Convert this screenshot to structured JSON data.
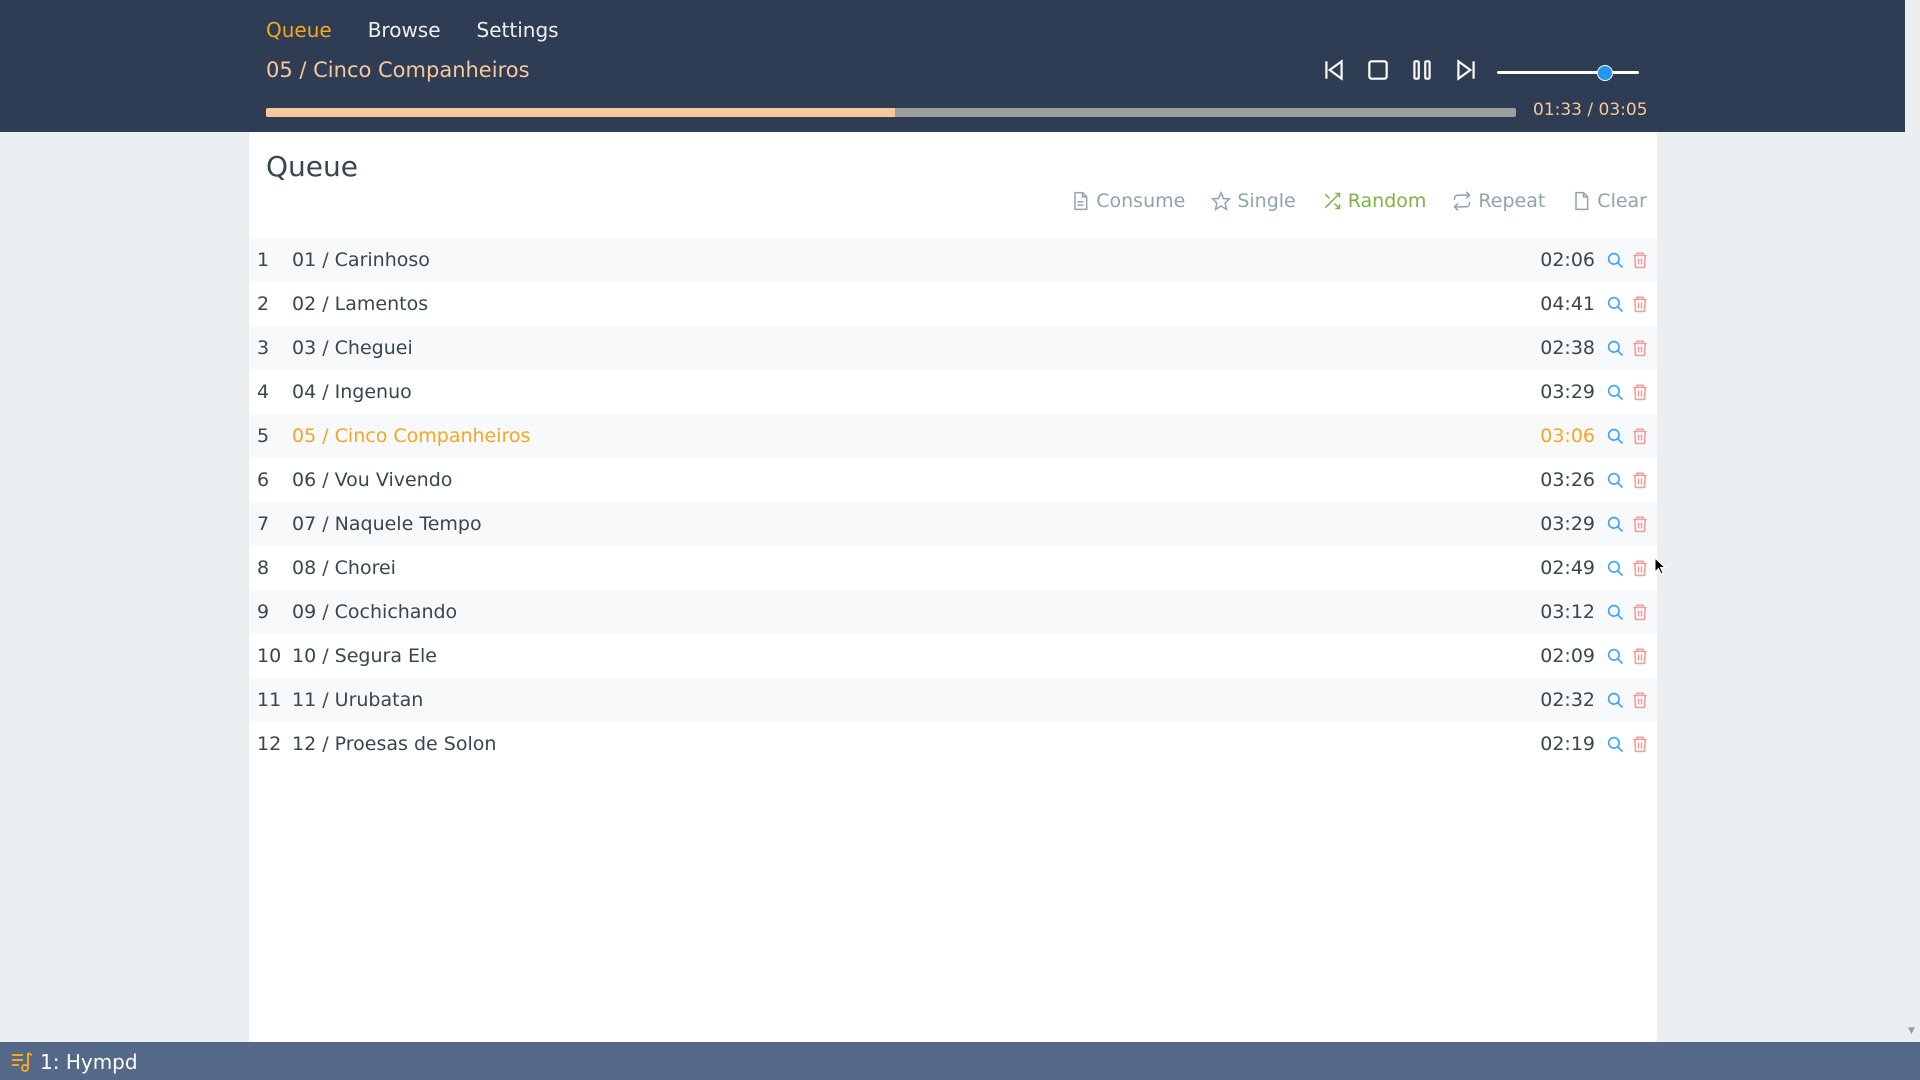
{
  "nav": {
    "items": [
      "Queue",
      "Browse",
      "Settings"
    ],
    "active": "Queue"
  },
  "now_playing": {
    "title": "05 / Cinco Companheiros",
    "elapsed_total": "01:33 / 03:05",
    "progress_fraction": 0.503
  },
  "controls": {
    "icons": [
      "skip-previous-icon",
      "stop-icon",
      "pause-icon",
      "skip-next-icon"
    ]
  },
  "volume": {
    "level_fraction": 0.76
  },
  "queue": {
    "title": "Queue",
    "toolbar": {
      "consume": "Consume",
      "single": "Single",
      "random": "Random",
      "repeat": "Repeat",
      "clear": "Clear"
    },
    "rows": [
      {
        "num": "1",
        "title": "01 / Carinhoso",
        "duration": "02:06"
      },
      {
        "num": "2",
        "title": "02 / Lamentos",
        "duration": "04:41"
      },
      {
        "num": "3",
        "title": "03 / Cheguei",
        "duration": "02:38"
      },
      {
        "num": "4",
        "title": "04 / Ingenuo",
        "duration": "03:29"
      },
      {
        "num": "5",
        "title": "05 / Cinco Companheiros",
        "duration": "03:06",
        "playing": true
      },
      {
        "num": "6",
        "title": "06 / Vou Vivendo",
        "duration": "03:26"
      },
      {
        "num": "7",
        "title": "07 / Naquele Tempo",
        "duration": "03:29"
      },
      {
        "num": "8",
        "title": "08 / Chorei",
        "duration": "02:49"
      },
      {
        "num": "9",
        "title": "09 / Cochichando",
        "duration": "03:12"
      },
      {
        "num": "10",
        "title": "10 / Segura Ele",
        "duration": "02:09"
      },
      {
        "num": "11",
        "title": "11 / Urubatan",
        "duration": "02:32"
      },
      {
        "num": "12",
        "title": "12 / Proesas de Solon",
        "duration": "02:19"
      }
    ]
  },
  "taskbar": {
    "label": "1: Hympd"
  },
  "colors": {
    "header_bg": "#2f3d54",
    "accent_orange": "#f5a623",
    "active_green": "#7cb342",
    "search_blue": "#42a5f5",
    "delete_red": "#ef9a9a",
    "taskbar_bg": "#546888"
  }
}
